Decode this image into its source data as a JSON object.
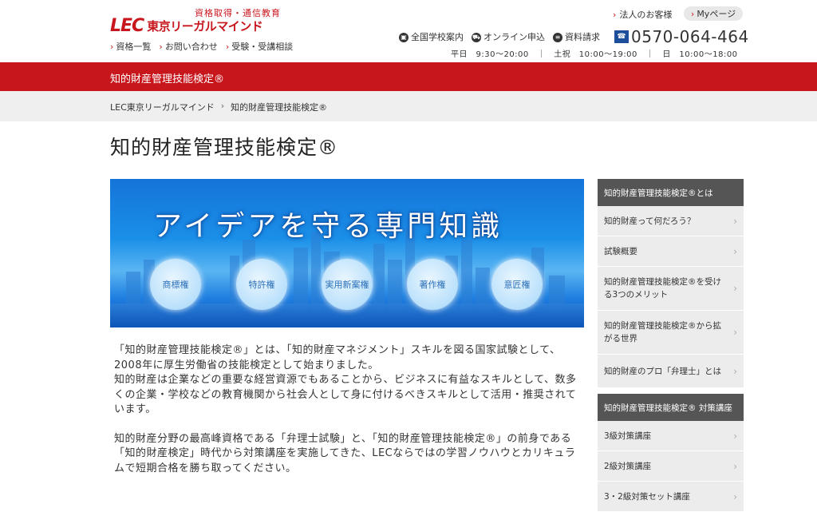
{
  "header": {
    "tagline": "資格取得・通信教育",
    "logo_mark": "LEC",
    "logo_name": "東京リーガルマインド",
    "links": [
      "資格一覧",
      "お問い合わせ",
      "受験・受講相談"
    ],
    "corp_link": "法人のお客様",
    "mypage": "Myページ",
    "utils": [
      {
        "icon": "school-icon",
        "label": "全国学校案内"
      },
      {
        "icon": "cart-icon",
        "label": "オンライン申込"
      },
      {
        "icon": "document-icon",
        "label": "資料請求"
      }
    ],
    "phone": "0570-064-464",
    "hours": "平日　9:30〜20:00　｜　土祝　10:00〜19:00　｜　日　10:00〜18:00"
  },
  "redbar_title": "知的財産管理技能検定®",
  "breadcrumb": [
    "LEC東京リーガルマインド",
    "知的財産管理技能検定®"
  ],
  "page_title": "知的財産管理技能検定®",
  "banner": {
    "catch": "アイデアを守る専門知識",
    "bubbles": [
      "商標権",
      "特許権",
      "実用新案権",
      "著作権",
      "意匠権"
    ]
  },
  "body": {
    "para1": "「知的財産管理技能検定®」とは、「知的財産マネジメント」スキルを図る国家試験として、2008年に厚生労働省の技能検定として始まりました。\n知的財産は企業などの重要な経営資源でもあることから、ビジネスに有益なスキルとして、数多くの企業・学校などの教育機関から社会人として身に付けるべきスキルとして活用・推奨されています。",
    "para2": "知的財産分野の最高峰資格である「弁理士試験」と、「知的財産管理技能検定®」の前身である「知的財産検定」時代から対策講座を実施してきた、LECならではの学習ノウハウとカリキュラムで短期合格を勝ち取ってください。"
  },
  "sidebar": {
    "section1_head": "知的財産管理技能検定®とは",
    "section1_items": [
      "知的財産って何だろう？",
      "試験概要",
      "知的財産管理技能検定®を受ける3つのメリット",
      "知的財産管理技能検定®から拡がる世界",
      "知的財産のプロ「弁理士」とは"
    ],
    "section2_head": "知的財産管理技能検定® 対策講座",
    "section2_items": [
      "3級対策講座",
      "2級対策講座",
      "3・2級対策セット講座"
    ]
  }
}
